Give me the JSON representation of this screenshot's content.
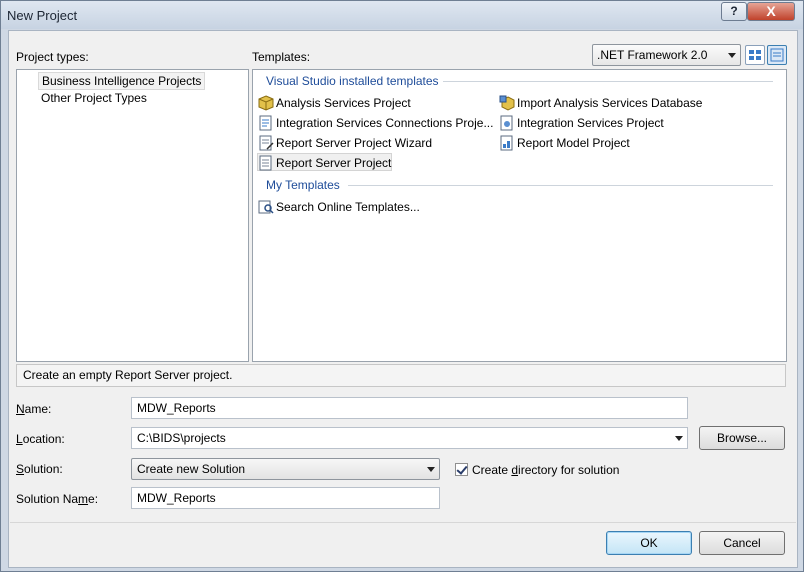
{
  "window": {
    "title": "New Project",
    "help_label": "?",
    "close_label": "X"
  },
  "project_types": {
    "label": "Project types:",
    "items": [
      "Business Intelligence Projects",
      "Other Project Types"
    ],
    "selected_index": 0
  },
  "templates": {
    "label": "Templates:",
    "framework": ".NET Framework 2.0",
    "groups": [
      {
        "header": "Visual Studio installed templates",
        "items": [
          {
            "label": "Analysis Services Project",
            "icon": "cube-icon"
          },
          {
            "label": "Import Analysis Services Database",
            "icon": "cube-import-icon"
          },
          {
            "label": "Integration Services Connections Proje...",
            "icon": "integration-connections-icon"
          },
          {
            "label": "Integration Services Project",
            "icon": "integration-services-icon"
          },
          {
            "label": "Report Server Project Wizard",
            "icon": "report-wizard-icon"
          },
          {
            "label": "Report Model Project",
            "icon": "report-model-icon"
          },
          {
            "label": "Report Server Project",
            "icon": "report-server-icon"
          }
        ]
      },
      {
        "header": "My Templates",
        "items": [
          {
            "label": "Search Online Templates...",
            "icon": "search-online-icon"
          }
        ]
      }
    ],
    "selected": "Report Server Project"
  },
  "description": "Create an empty Report Server project.",
  "form": {
    "name_label": "Name:",
    "name_value": "MDW_Reports",
    "location_label": "Location:",
    "location_value": "C:\\BIDS\\projects",
    "browse_label": "Browse...",
    "solution_label": "Solution:",
    "solution_value": "Create new Solution",
    "create_dir_label": "Create directory for solution",
    "create_dir_checked": true,
    "solution_name_label": "Solution Name:",
    "solution_name_value": "MDW_Reports"
  },
  "buttons": {
    "ok": "OK",
    "cancel": "Cancel"
  }
}
